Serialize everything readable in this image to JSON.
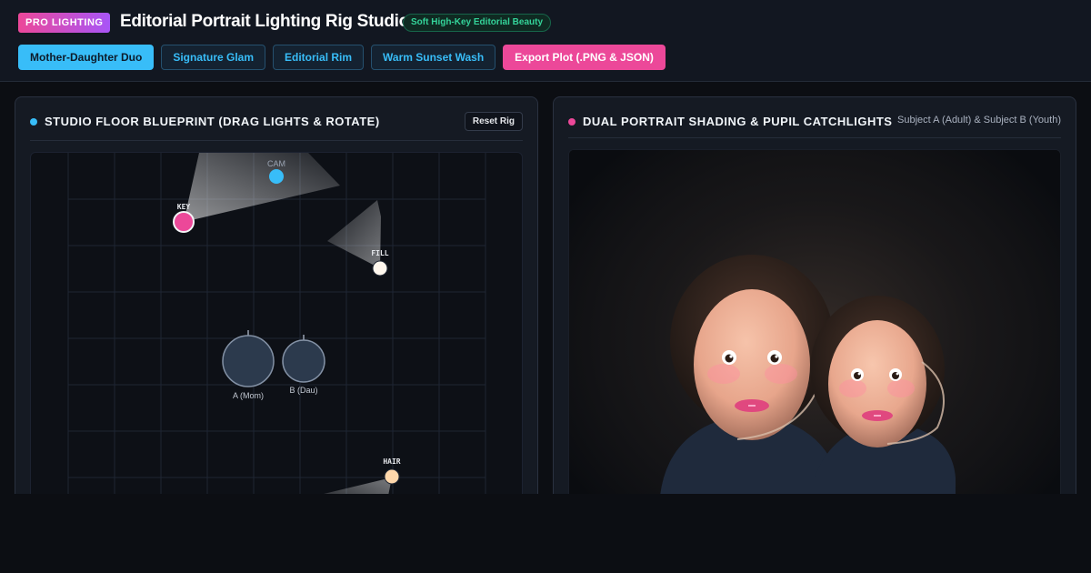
{
  "header": {
    "badge": "PRO LIGHTING",
    "title": "Editorial Portrait Lighting Rig Studio",
    "preset_tag": "Soft High-Key Editorial Beauty"
  },
  "presets": {
    "active": "Mother-Daughter Duo",
    "items": [
      "Mother-Daughter Duo",
      "Signature Glam",
      "Editorial Rim",
      "Warm Sunset Wash"
    ],
    "export_label": "Export Plot (.PNG & JSON)"
  },
  "blueprint": {
    "title": "STUDIO FLOOR BLUEPRINT (DRAG LIGHTS & ROTATE)",
    "reset_label": "Reset Rig",
    "camera_label": "CAM",
    "lights": [
      {
        "id": "key",
        "label": "KEY",
        "color": "#ec4899"
      },
      {
        "id": "fill",
        "label": "FILL",
        "color": "#fff7ed"
      },
      {
        "id": "hair",
        "label": "HAIR",
        "color": "#fed7aa"
      }
    ],
    "subjects": [
      {
        "id": "a",
        "label": "A (Mom)"
      },
      {
        "id": "b",
        "label": "B (Dau)"
      }
    ]
  },
  "portrait": {
    "title": "DUAL PORTRAIT SHADING & PUPIL CATCHLIGHTS",
    "subtitle": "Subject A (Adult) & Subject B (Youth)"
  },
  "colors": {
    "accent_blue": "#38bdf8",
    "accent_pink": "#ec4899",
    "tag_green": "#34d399",
    "skin": "#f2b59c",
    "lips": "#e0487f",
    "shirt": "#1f2a3c"
  }
}
